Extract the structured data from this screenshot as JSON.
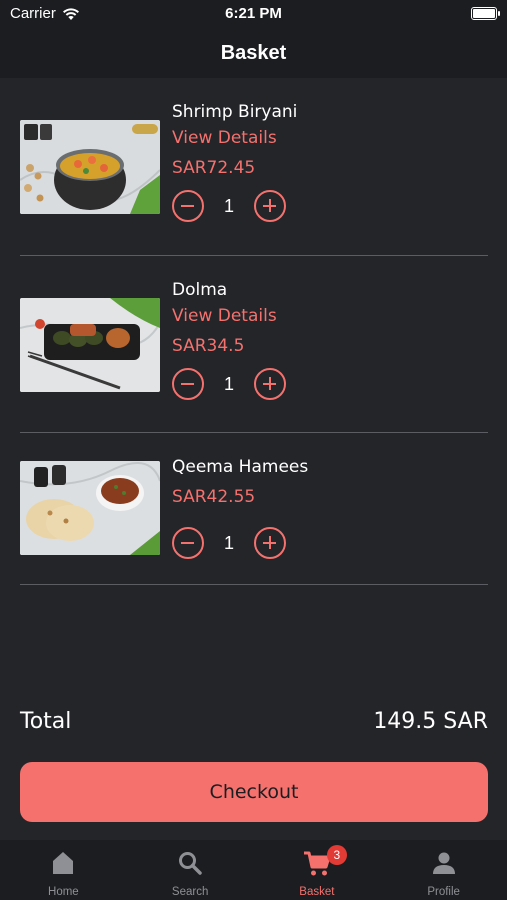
{
  "status_bar": {
    "carrier": "Carrier",
    "time": "6:21 PM"
  },
  "header": {
    "title": "Basket"
  },
  "items": [
    {
      "name": "Shrimp Biryani",
      "details_label": "View Details",
      "price": "SAR72.45",
      "quantity": "1"
    },
    {
      "name": "Dolma",
      "details_label": "View Details",
      "price": "SAR34.5",
      "quantity": "1"
    },
    {
      "name": "Qeema Hamees",
      "price": "SAR42.55",
      "quantity": "1"
    }
  ],
  "total": {
    "label": "Total",
    "value": "149.5 SAR"
  },
  "checkout": {
    "label": "Checkout"
  },
  "tabs": [
    {
      "label": "Home",
      "icon": "home-icon"
    },
    {
      "label": "Search",
      "icon": "search-icon"
    },
    {
      "label": "Basket",
      "icon": "cart-icon",
      "badge": "3",
      "active": true
    },
    {
      "label": "Profile",
      "icon": "person-icon"
    }
  ],
  "colors": {
    "background": "#242529",
    "bar": "#1c1d20",
    "accent": "#f4716e",
    "badge": "#e23b36",
    "divider": "#5b5d62"
  }
}
